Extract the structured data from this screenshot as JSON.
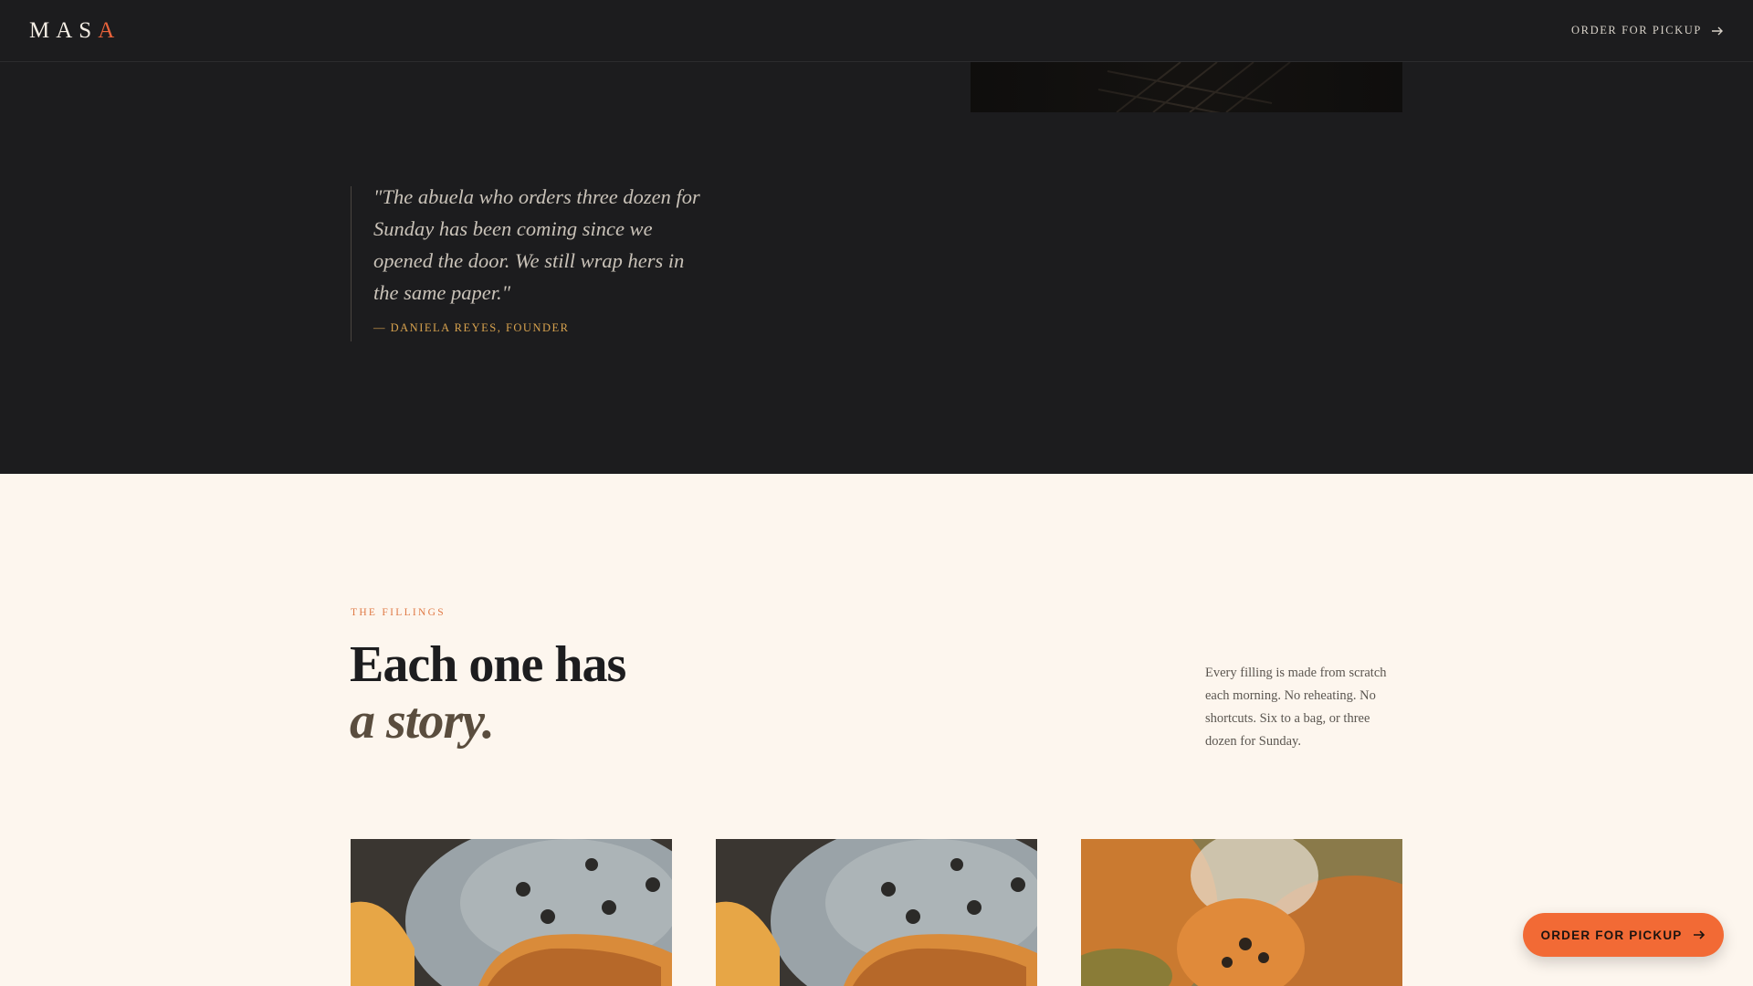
{
  "nav": {
    "logo_main": "MAS",
    "logo_accent": "A",
    "order_label": "ORDER FOR PICKUP",
    "arrow_icon": "arrow-right-icon"
  },
  "hero": {
    "image_icon": "food-photo"
  },
  "quote": {
    "text": "\"The abuela who orders three dozen for Sunday has been coming since we opened the door. We still wrap hers in the same paper.\"",
    "author": "— DANIELA REYES, FOUNDER"
  },
  "fillings": {
    "eyebrow": "THE FILLINGS",
    "heading_line1": "Each one has",
    "heading_line2": "a story.",
    "intro": "Every filling is made from scratch each morning. No reheating. No shortcuts. Six to a bag, or three dozen for Sunday."
  },
  "cards": [
    {
      "image": "empanada-photo"
    },
    {
      "image": "empanada-photo"
    },
    {
      "image": "filling-closeup-photo"
    }
  ],
  "fab": {
    "label": "ORDER FOR PICKUP"
  },
  "colors": {
    "dark_bg": "#1c1c1e",
    "light_bg": "#fdf6ee",
    "accent": "#f26a35",
    "gold": "#d7a24e"
  }
}
